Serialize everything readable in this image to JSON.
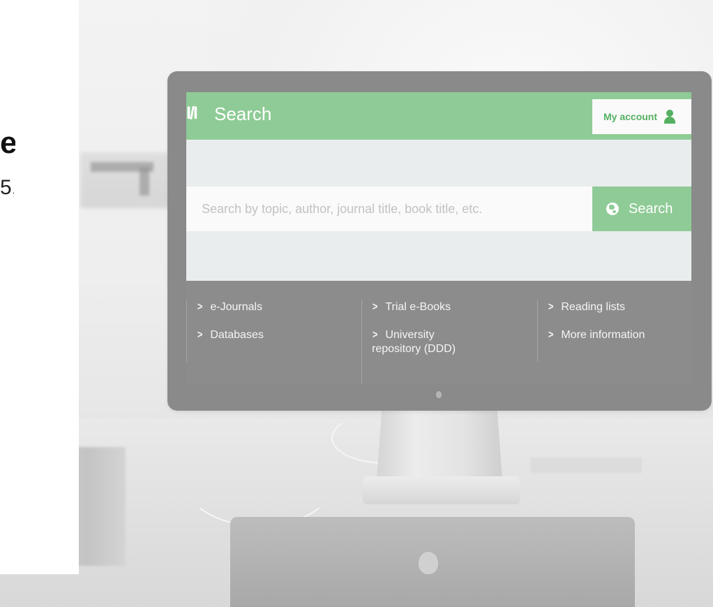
{
  "page_heading_fragment": "e",
  "page_subtext_fragment": "5,",
  "app": {
    "logo": "I/I",
    "title": "Search",
    "accent": "#8fcb96"
  },
  "header": {
    "account_label": "My account",
    "account_icon": "user-icon"
  },
  "search": {
    "placeholder": "Search by topic, author, journal title, book title, etc.",
    "value": "",
    "button_label": "Search",
    "button_icon": "globe-icon"
  },
  "links": {
    "col1": [
      "e-Journals",
      "Databases"
    ],
    "col2": [
      "Trial e-Books",
      "University repository (DDD)"
    ],
    "col3": [
      "Reading lists",
      "More information"
    ]
  }
}
